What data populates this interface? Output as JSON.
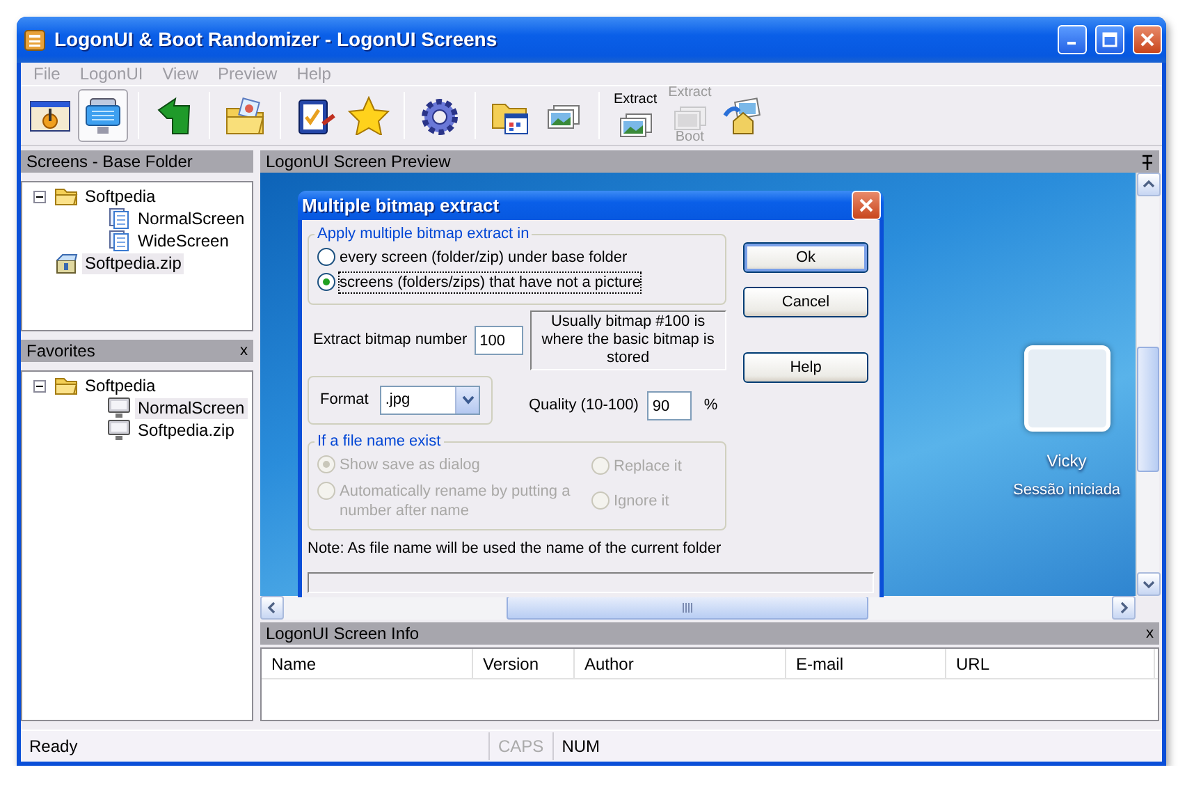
{
  "window": {
    "title": "LogonUI & Boot Randomizer - LogonUI Screens"
  },
  "menu": [
    {
      "label": "File",
      "disabled": true
    },
    {
      "label": "LogonUI",
      "disabled": true
    },
    {
      "label": "View",
      "disabled": true
    },
    {
      "label": "Preview",
      "disabled": true
    },
    {
      "label": "Help",
      "disabled": true
    }
  ],
  "toolbar": [
    {
      "kind": "button",
      "pressed": false,
      "disabled": false
    },
    {
      "kind": "button",
      "pressed": true,
      "disabled": false
    },
    {
      "kind": "separator"
    },
    {
      "kind": "button",
      "pressed": false,
      "disabled": false
    },
    {
      "kind": "separator"
    },
    {
      "kind": "button",
      "pressed": false,
      "disabled": false
    },
    {
      "kind": "separator"
    },
    {
      "kind": "button",
      "pressed": false,
      "disabled": false
    },
    {
      "kind": "button",
      "pressed": false,
      "disabled": false
    },
    {
      "kind": "separator"
    },
    {
      "kind": "button",
      "pressed": false,
      "disabled": false
    },
    {
      "kind": "separator"
    },
    {
      "kind": "button",
      "pressed": false,
      "disabled": false
    },
    {
      "kind": "button",
      "pressed": false,
      "disabled": false
    },
    {
      "kind": "separator"
    },
    {
      "kind": "button",
      "pressed": false,
      "disabled": false,
      "labels": [
        "Extract"
      ]
    },
    {
      "kind": "button",
      "pressed": false,
      "disabled": true,
      "labels": [
        "Extract",
        "Boot"
      ]
    },
    {
      "kind": "button",
      "pressed": false,
      "disabled": false
    }
  ],
  "base_folder": {
    "title": "Screens - Base Folder",
    "tree": [
      {
        "label": "Softpedia",
        "kind": "folder",
        "expanded": true,
        "selected": false,
        "children": [
          {
            "label": "NormalScreen",
            "kind": "page",
            "selected": false
          },
          {
            "label": "WideScreen",
            "kind": "page",
            "selected": false
          }
        ]
      },
      {
        "label": "Softpedia.zip",
        "kind": "zip",
        "selected": true
      }
    ]
  },
  "favorites": {
    "title": "Favorites",
    "close": "x",
    "tree": [
      {
        "label": "Softpedia",
        "kind": "folder",
        "expanded": true,
        "selected": false,
        "children": [
          {
            "label": "NormalScreen",
            "kind": "monitor",
            "selected": true
          },
          {
            "label": "Softpedia.zip",
            "kind": "monitor",
            "selected": false
          }
        ]
      }
    ]
  },
  "preview": {
    "title": "LogonUI Screen Preview",
    "user_name": "Vicky",
    "user_status": "Sessão iniciada"
  },
  "dialog": {
    "title": "Multiple bitmap extract",
    "apply_group": {
      "legend": "Apply multiple bitmap extract in",
      "options": [
        {
          "label": "every screen (folder/zip) under base folder",
          "selected": false,
          "focused": false
        },
        {
          "label": "screens (folders/zips) that have not a picture",
          "selected": true,
          "focused": true
        }
      ]
    },
    "bitmap_number": {
      "label": "Extract bitmap number",
      "value": "100",
      "hint": "Usually bitmap #100 is where the basic bitmap is stored"
    },
    "format": {
      "label": "Format",
      "value": ".jpg"
    },
    "quality": {
      "label": "Quality (10-100)",
      "value": "90",
      "unit": "%"
    },
    "file_exists_group": {
      "legend": "If a file name exist",
      "disabled": true,
      "options": [
        {
          "label": "Show save as dialog",
          "selected": true
        },
        {
          "label": "Replace it",
          "selected": false
        },
        {
          "label": "Automatically rename by putting a number after name",
          "selected": false
        },
        {
          "label": "Ignore it",
          "selected": false
        }
      ]
    },
    "note": "Note: As file name will be used the name of the current folder",
    "progress": {
      "level": 0
    },
    "buttons": [
      {
        "label": "Ok",
        "default": true
      },
      {
        "label": "Cancel",
        "default": false
      },
      {
        "label": "Help",
        "default": false
      }
    ]
  },
  "info": {
    "title": "LogonUI Screen Info",
    "close": "x",
    "columns": [
      "Name",
      "Version",
      "Author",
      "E-mail",
      "URL"
    ]
  },
  "status_bar": [
    {
      "text": "Ready",
      "on": true
    },
    {
      "text": "CAPS",
      "on": false
    },
    {
      "text": "NUM",
      "on": true
    }
  ]
}
